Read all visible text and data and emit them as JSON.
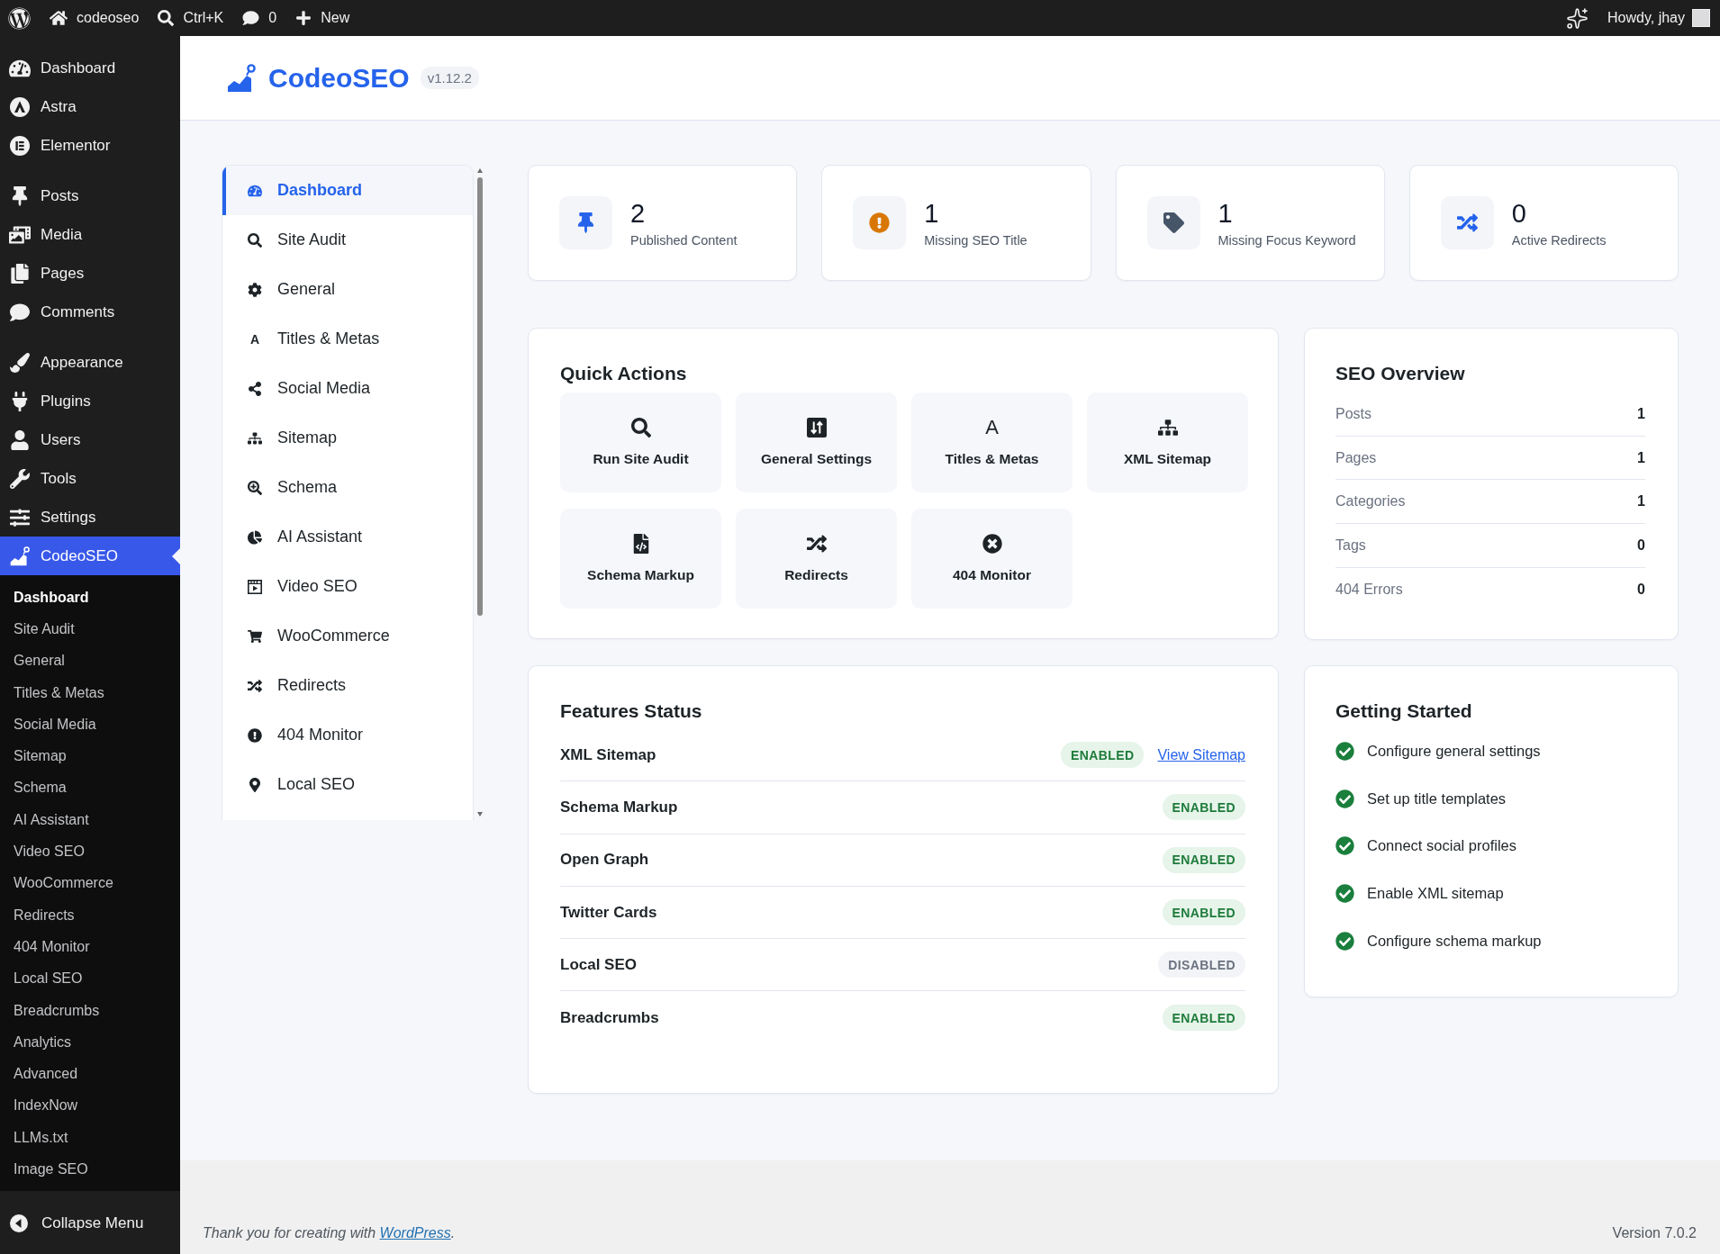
{
  "admin_bar": {
    "site_name": "codeoseo",
    "search_shortcut": "Ctrl+K",
    "comment_count": "0",
    "new_label": "New",
    "greeting": "Howdy, jhay"
  },
  "admin_menu": {
    "groups": [
      {
        "items": [
          {
            "label": "Dashboard",
            "selected": false
          },
          {
            "label": "Astra",
            "selected": false
          },
          {
            "label": "Elementor",
            "selected": false
          }
        ]
      },
      {
        "items": [
          {
            "label": "Posts",
            "selected": false
          },
          {
            "label": "Media",
            "selected": false
          },
          {
            "label": "Pages",
            "selected": false
          },
          {
            "label": "Comments",
            "selected": false
          }
        ]
      },
      {
        "items": [
          {
            "label": "Appearance",
            "selected": false
          },
          {
            "label": "Plugins",
            "selected": false
          },
          {
            "label": "Users",
            "selected": false
          },
          {
            "label": "Tools",
            "selected": false
          },
          {
            "label": "Settings",
            "selected": false
          },
          {
            "label": "CodeoSEO",
            "selected": true
          }
        ]
      }
    ],
    "submenu": [
      {
        "label": "Dashboard",
        "selected": true
      },
      {
        "label": "Site Audit",
        "selected": false
      },
      {
        "label": "General",
        "selected": false
      },
      {
        "label": "Titles & Metas",
        "selected": false
      },
      {
        "label": "Social Media",
        "selected": false
      },
      {
        "label": "Sitemap",
        "selected": false
      },
      {
        "label": "Schema",
        "selected": false
      },
      {
        "label": "AI Assistant",
        "selected": false
      },
      {
        "label": "Video SEO",
        "selected": false
      },
      {
        "label": "WooCommerce",
        "selected": false
      },
      {
        "label": "Redirects",
        "selected": false
      },
      {
        "label": "404 Monitor",
        "selected": false
      },
      {
        "label": "Local SEO",
        "selected": false
      },
      {
        "label": "Breadcrumbs",
        "selected": false
      },
      {
        "label": "Analytics",
        "selected": false
      },
      {
        "label": "Advanced",
        "selected": false
      },
      {
        "label": "IndexNow",
        "selected": false
      },
      {
        "label": "LLMs.txt",
        "selected": false
      },
      {
        "label": "Image SEO",
        "selected": false
      }
    ],
    "collapse_label": "Collapse Menu"
  },
  "header": {
    "title": "CodeoSEO",
    "version": "v1.12.2"
  },
  "plugin_nav": {
    "items": [
      {
        "label": "Dashboard",
        "selected": true
      },
      {
        "label": "Site Audit",
        "selected": false
      },
      {
        "label": "General",
        "selected": false
      },
      {
        "label": "Titles & Metas",
        "glyph": "A",
        "selected": false
      },
      {
        "label": "Social Media",
        "selected": false
      },
      {
        "label": "Sitemap",
        "selected": false
      },
      {
        "label": "Schema",
        "selected": false
      },
      {
        "label": "AI Assistant",
        "selected": false
      },
      {
        "label": "Video SEO",
        "selected": false
      },
      {
        "label": "WooCommerce",
        "selected": false
      },
      {
        "label": "Redirects",
        "selected": false
      },
      {
        "label": "404 Monitor",
        "selected": false
      },
      {
        "label": "Local SEO",
        "selected": false
      }
    ]
  },
  "stats": [
    {
      "value": "2",
      "label": "Published Content"
    },
    {
      "value": "1",
      "label": "Missing SEO Title"
    },
    {
      "value": "1",
      "label": "Missing Focus Keyword"
    },
    {
      "value": "0",
      "label": "Active Redirects"
    }
  ],
  "quick_actions": {
    "title": "Quick Actions",
    "items": [
      {
        "label": "Run Site Audit"
      },
      {
        "label": "General Settings"
      },
      {
        "label": "Titles & Metas",
        "glyph": "A"
      },
      {
        "label": "XML Sitemap"
      },
      {
        "label": "Schema Markup"
      },
      {
        "label": "Redirects"
      },
      {
        "label": "404 Monitor"
      }
    ]
  },
  "seo_overview": {
    "title": "SEO Overview",
    "rows": [
      {
        "label": "Posts",
        "value": "1"
      },
      {
        "label": "Pages",
        "value": "1"
      },
      {
        "label": "Categories",
        "value": "1"
      },
      {
        "label": "Tags",
        "value": "0"
      },
      {
        "label": "404 Errors",
        "value": "0"
      }
    ]
  },
  "features_status": {
    "title": "Features Status",
    "rows": [
      {
        "label": "XML Sitemap",
        "status": "ENABLED",
        "enabled": true,
        "link": "View Sitemap"
      },
      {
        "label": "Schema Markup",
        "status": "ENABLED",
        "enabled": true
      },
      {
        "label": "Open Graph",
        "status": "ENABLED",
        "enabled": true
      },
      {
        "label": "Twitter Cards",
        "status": "ENABLED",
        "enabled": true
      },
      {
        "label": "Local SEO",
        "status": "DISABLED",
        "enabled": false
      },
      {
        "label": "Breadcrumbs",
        "status": "ENABLED",
        "enabled": true
      }
    ]
  },
  "getting_started": {
    "title": "Getting Started",
    "items": [
      {
        "label": "Configure general settings",
        "done": true
      },
      {
        "label": "Set up title templates",
        "done": true
      },
      {
        "label": "Connect social profiles",
        "done": true
      },
      {
        "label": "Enable XML sitemap",
        "done": true
      },
      {
        "label": "Configure schema markup",
        "done": true
      }
    ]
  },
  "footer": {
    "credit": "Thank you for creating with",
    "credit_link": "WordPress",
    "credit_end": ".",
    "version": "Version 7.0.2"
  }
}
